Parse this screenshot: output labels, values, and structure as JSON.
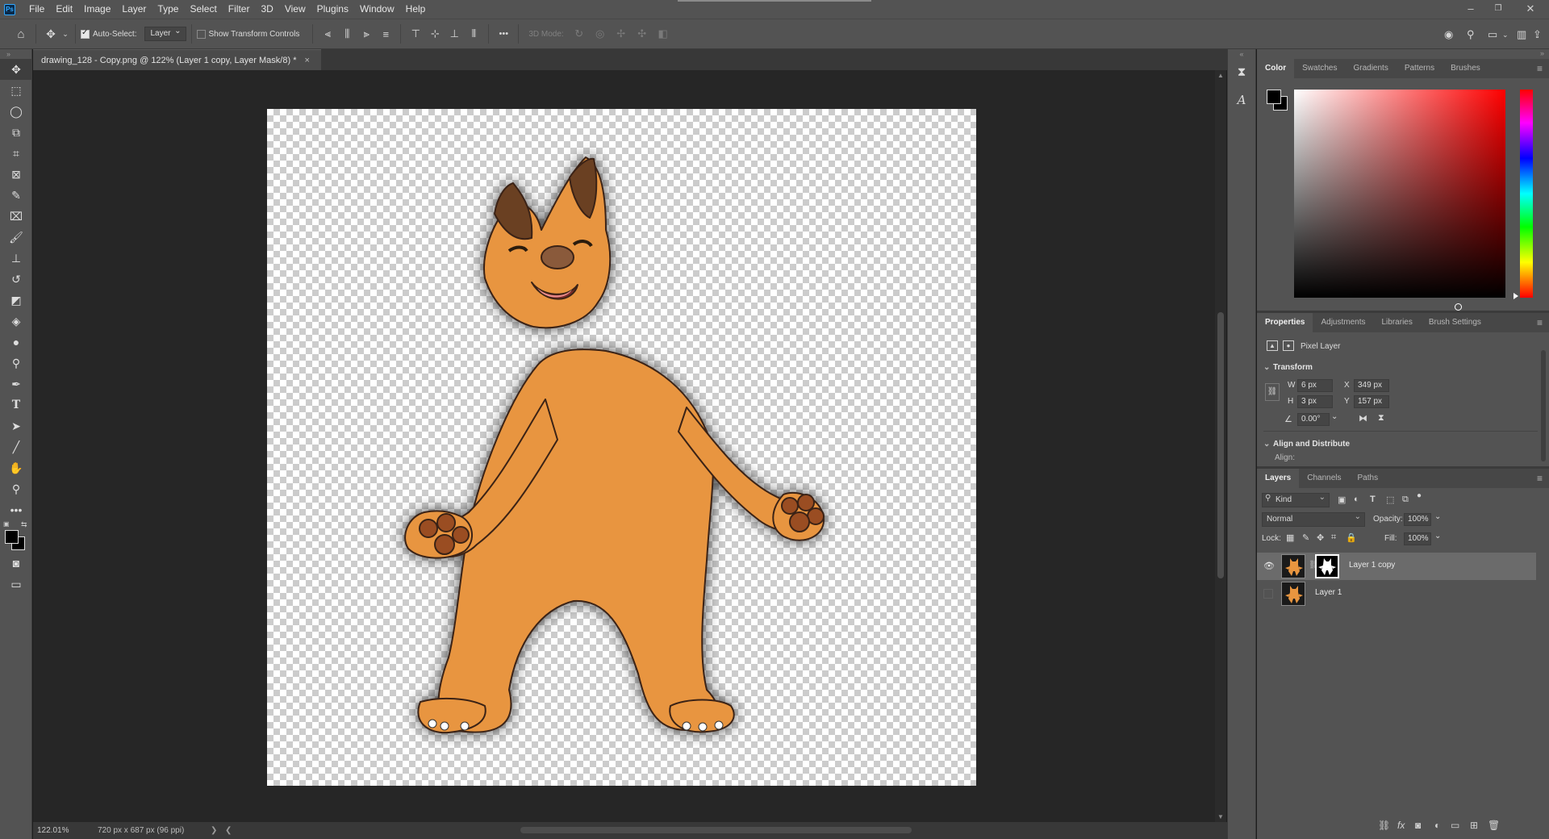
{
  "app": {
    "logo": "Ps"
  },
  "menu": [
    "File",
    "Edit",
    "Image",
    "Layer",
    "Type",
    "Select",
    "Filter",
    "3D",
    "View",
    "Plugins",
    "Window",
    "Help"
  ],
  "window_controls": {
    "minimize": "–",
    "restore": "❐",
    "close": "✕"
  },
  "options_bar": {
    "auto_select_label": "Auto-Select:",
    "auto_select_checked": true,
    "auto_select_value": "Layer",
    "show_transform_label": "Show Transform Controls",
    "show_transform_checked": false,
    "more": "•••",
    "mode_3d_label": "3D Mode:"
  },
  "document": {
    "tab_title": "drawing_128 - Copy.png @ 122% (Layer 1 copy, Layer Mask/8) *",
    "close": "×"
  },
  "status": {
    "zoom": "122.01%",
    "doc_info": "720 px x 687 px (96 ppi)",
    "nav_right": "❯",
    "nav_left": "❮"
  },
  "color_panel": {
    "tabs": [
      "Color",
      "Swatches",
      "Gradients",
      "Patterns",
      "Brushes"
    ],
    "active_tab": "Color",
    "foreground": "#000000",
    "background": "#000000",
    "hue": "#ff0000"
  },
  "properties_panel": {
    "tabs": [
      "Properties",
      "Adjustments",
      "Libraries",
      "Brush Settings"
    ],
    "active_tab": "Properties",
    "layer_type": "Pixel Layer",
    "transform_title": "Transform",
    "w_label": "W",
    "w_value": "6 px",
    "h_label": "H",
    "h_value": "3 px",
    "x_label": "X",
    "x_value": "349 px",
    "y_label": "Y",
    "y_value": "157 px",
    "angle_value": "0.00°",
    "align_title": "Align and Distribute",
    "align_label": "Align:"
  },
  "layers_panel": {
    "tabs": [
      "Layers",
      "Channels",
      "Paths"
    ],
    "active_tab": "Layers",
    "filter_kind": "Kind",
    "blend_mode": "Normal",
    "opacity_label": "Opacity:",
    "opacity_value": "100%",
    "lock_label": "Lock:",
    "fill_label": "Fill:",
    "fill_value": "100%",
    "layers": [
      {
        "name": "Layer 1 copy",
        "visible": true,
        "selected": true,
        "has_mask": true
      },
      {
        "name": "Layer 1",
        "visible": false,
        "selected": false,
        "has_mask": false
      }
    ]
  },
  "colors": {
    "ui_bg": "#535353",
    "canvas_bg": "#262626",
    "fox_fur": "#e8953f",
    "fox_paws": "#9a4e22",
    "fox_ears": "#6b3f22"
  }
}
